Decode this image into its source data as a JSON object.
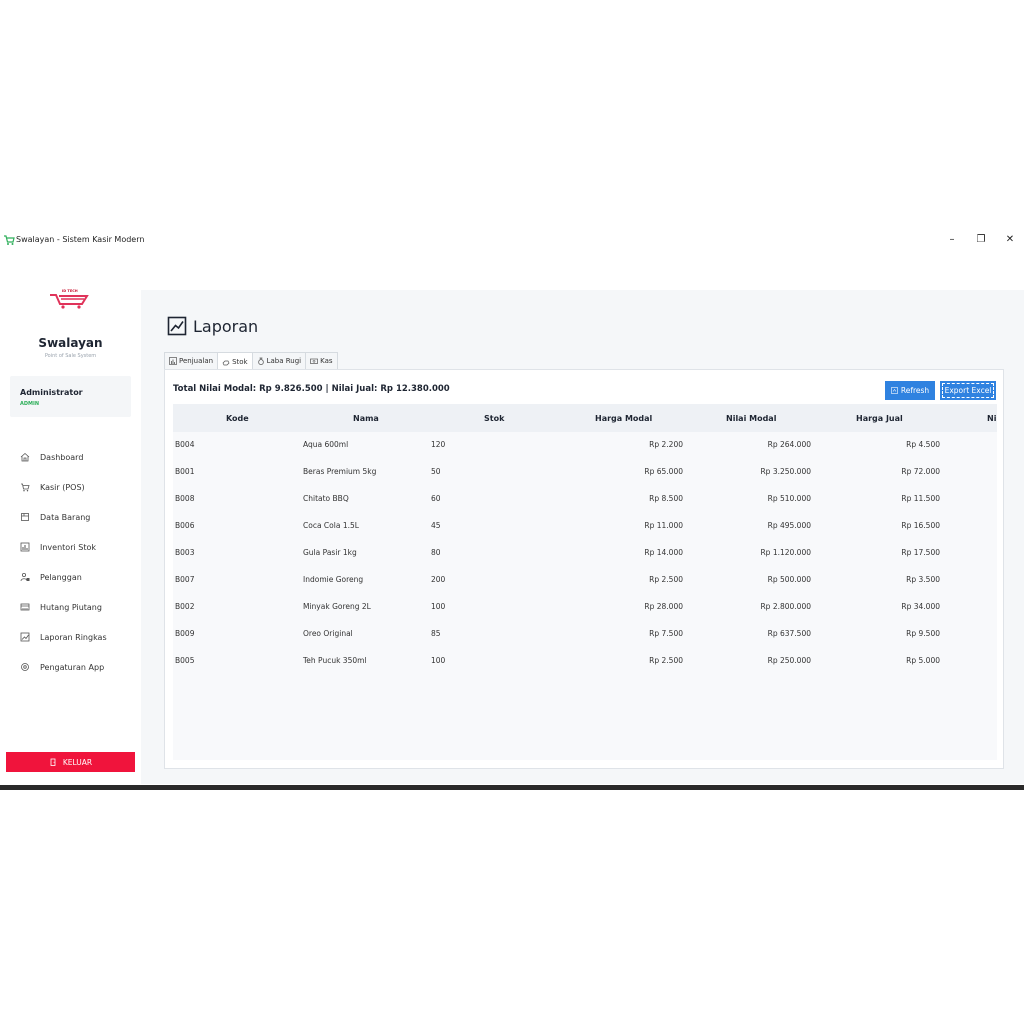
{
  "window": {
    "title": "Swalayan - Sistem Kasir Modern",
    "controls": {
      "minimize": "–",
      "maximize": "❐",
      "close": "✕"
    }
  },
  "sidebar": {
    "logo_text": "ID TECH",
    "brand_name": "Swalayan",
    "brand_subtitle": "Point of Sale System",
    "user": {
      "name": "Administrator",
      "role": "ADMIN"
    },
    "items": [
      {
        "label": "Dashboard",
        "icon": "home-icon"
      },
      {
        "label": "Kasir (POS)",
        "icon": "cart-icon"
      },
      {
        "label": "Data Barang",
        "icon": "box-icon"
      },
      {
        "label": "Inventori Stok",
        "icon": "chart-bar-icon"
      },
      {
        "label": "Pelanggan",
        "icon": "users-icon"
      },
      {
        "label": "Hutang Piutang",
        "icon": "credit-card-icon"
      },
      {
        "label": "Laporan Ringkas",
        "icon": "line-chart-icon"
      },
      {
        "label": "Pengaturan App",
        "icon": "gear-icon"
      }
    ],
    "logout_label": "KELUAR"
  },
  "main": {
    "title": "Laporan",
    "tabs": [
      {
        "label": "Penjualan",
        "icon": "chart-bar-icon"
      },
      {
        "label": "Stok",
        "icon": "hand-icon"
      },
      {
        "label": "Laba Rugi",
        "icon": "money-bag-icon"
      },
      {
        "label": "Kas",
        "icon": "cash-icon"
      }
    ],
    "active_tab": "Stok",
    "summary": "Total Nilai Modal: Rp 9.826.500 | Nilai Jual: Rp 12.380.000",
    "refresh_label": "Refresh",
    "export_label": "Export Excel",
    "table": {
      "columns": [
        "Kode",
        "Nama",
        "Stok",
        "Harga Modal",
        "Nilai Modal",
        "Harga Jual",
        "Ni"
      ],
      "rows": [
        [
          "B004",
          "Aqua 600ml",
          "120",
          "Rp 2.200",
          "Rp 264.000",
          "Rp 4.500"
        ],
        [
          "B001",
          "Beras Premium 5kg",
          "50",
          "Rp 65.000",
          "Rp 3.250.000",
          "Rp 72.000"
        ],
        [
          "B008",
          "Chitato BBQ",
          "60",
          "Rp 8.500",
          "Rp 510.000",
          "Rp 11.500"
        ],
        [
          "B006",
          "Coca Cola 1.5L",
          "45",
          "Rp 11.000",
          "Rp 495.000",
          "Rp 16.500"
        ],
        [
          "B003",
          "Gula Pasir 1kg",
          "80",
          "Rp 14.000",
          "Rp 1.120.000",
          "Rp 17.500"
        ],
        [
          "B007",
          "Indomie Goreng",
          "200",
          "Rp 2.500",
          "Rp 500.000",
          "Rp 3.500"
        ],
        [
          "B002",
          "Minyak Goreng 2L",
          "100",
          "Rp 28.000",
          "Rp 2.800.000",
          "Rp 34.000"
        ],
        [
          "B009",
          "Oreo Original",
          "85",
          "Rp 7.500",
          "Rp 637.500",
          "Rp 9.500"
        ],
        [
          "B005",
          "Teh Pucuk 350ml",
          "100",
          "Rp 2.500",
          "Rp 250.000",
          "Rp 5.000"
        ]
      ]
    }
  }
}
